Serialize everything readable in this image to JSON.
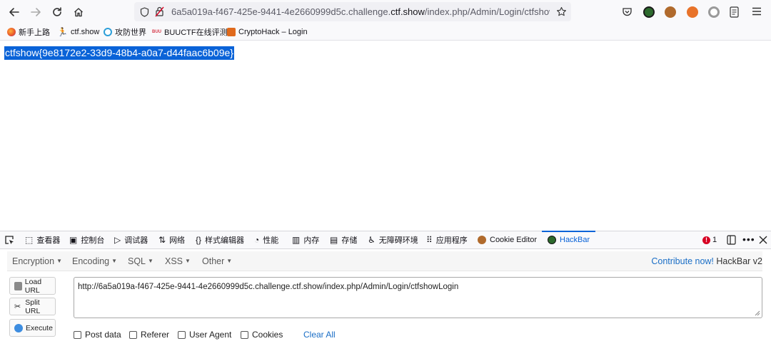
{
  "browser": {
    "url_prefix": "6a5a019a-f467-425e-9441-4e2660999d5c.challenge.",
    "url_domain": "ctf.show",
    "url_suffix": "/index.php/Admin/Login/ctfshowL",
    "bookmarks": [
      {
        "label": "新手上路",
        "icon": "firefox-icon",
        "color": "#e8542a"
      },
      {
        "label": "ctf.show",
        "icon": "runner-icon",
        "color": "#222222"
      },
      {
        "label": "攻防世界",
        "icon": "globe-icon",
        "color": "#2d9fd9"
      },
      {
        "label": "BUUCTF在线评测",
        "icon": "buu-icon",
        "color": "#d6394a"
      },
      {
        "label": "CryptoHack – Login",
        "icon": "cryptohack-icon",
        "color": "#e06a1c"
      }
    ]
  },
  "page": {
    "flag_text": "ctfshow{9e8172e2-33d9-48b4-a0a7-d44faac6b09e}"
  },
  "devtools": {
    "tabs": [
      {
        "label": "查看器",
        "icon": "inspector-icon"
      },
      {
        "label": "控制台",
        "icon": "console-icon"
      },
      {
        "label": "调试器",
        "icon": "debugger-icon"
      },
      {
        "label": "网络",
        "icon": "network-icon"
      },
      {
        "label": "样式编辑器",
        "icon": "style-editor-icon"
      },
      {
        "label": "性能",
        "icon": "performance-icon"
      },
      {
        "label": "内存",
        "icon": "memory-icon"
      },
      {
        "label": "存储",
        "icon": "storage-icon"
      },
      {
        "label": "无障碍环境",
        "icon": "accessibility-icon"
      },
      {
        "label": "应用程序",
        "icon": "application-icon"
      },
      {
        "label": "Cookie Editor",
        "icon": "cookie-icon"
      },
      {
        "label": "HackBar",
        "icon": "hackbar-icon",
        "active": true
      }
    ],
    "error_count": "1"
  },
  "hackbar": {
    "menu": [
      "Encryption",
      "Encoding",
      "SQL",
      "XSS",
      "Other"
    ],
    "contribute_link": "Contribute now!",
    "version_label": "HackBar v2",
    "buttons": [
      "Load URL",
      "Split URL",
      "Execute"
    ],
    "url_value": "http://6a5a019a-f467-425e-9441-4e2660999d5c.challenge.ctf.show/index.php/Admin/Login/ctfshowLogin",
    "checkboxes": [
      "Post data",
      "Referer",
      "User Agent",
      "Cookies"
    ],
    "clear_all": "Clear All",
    "accent_color": "#1a6ec6"
  }
}
